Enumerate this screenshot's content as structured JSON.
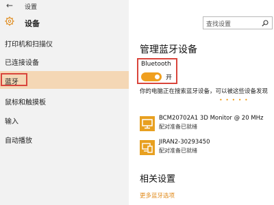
{
  "window": {
    "title": "设置"
  },
  "section": {
    "title": "设备"
  },
  "sidebar": {
    "items": [
      {
        "label": "打印机和扫描仪"
      },
      {
        "label": "已连接设备"
      },
      {
        "label": "蓝牙"
      },
      {
        "label": "鼠标和触摸板"
      },
      {
        "label": "输入"
      },
      {
        "label": "自动播放"
      }
    ]
  },
  "search": {
    "placeholder": "查找设置"
  },
  "main": {
    "heading": "管理蓝牙设备",
    "bluetooth_label": "Bluetooth",
    "toggle_state": "开",
    "description": "你的电脑正在搜索蓝牙设备，可以被这些设备发现",
    "progress_dots": "• • • • •",
    "devices": [
      {
        "name": "BCM20702A1 3D Monitor @ 20 MHz",
        "status": "配对准备已就绪",
        "icon": "monitor-icon"
      },
      {
        "name": "JIRAN2-30293450",
        "status": "配对准备已就绪",
        "icon": "device-icon"
      }
    ],
    "related_heading": "相关设置",
    "more_link": "更多蓝牙选项"
  },
  "colors": {
    "accent": "#f0a020",
    "active_nav": "#f4d7b5",
    "highlight_border": "#d9443b"
  }
}
